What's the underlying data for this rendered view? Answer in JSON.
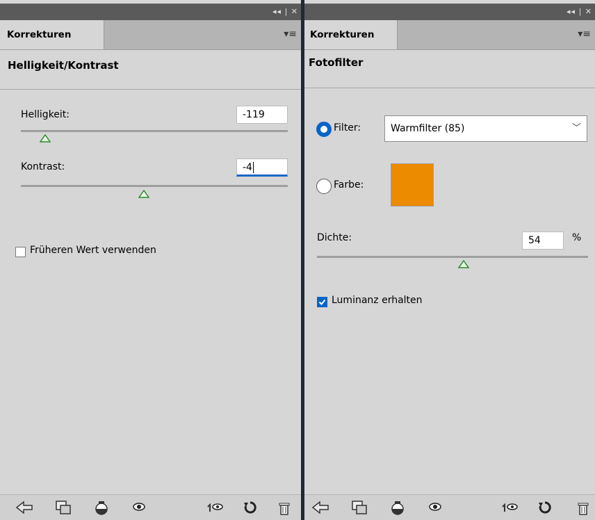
{
  "panels": [
    {
      "tab": "Korrekturen",
      "title": "Helligkeit/Kontrast",
      "controls": {
        "brightness": {
          "label": "Helligkeit:",
          "value": "-119",
          "slider_fraction": 0.09
        },
        "contrast": {
          "label": "Kontrast:",
          "value": "-4",
          "slider_fraction": 0.46
        },
        "legacy": {
          "label": "Früheren Wert verwenden",
          "checked": false
        }
      }
    },
    {
      "tab": "Korrekturen",
      "title": "Fotofilter",
      "controls": {
        "filter": {
          "label": "Filter:",
          "selected": true,
          "option": "Warmfilter (85)"
        },
        "color": {
          "label": "Farbe:",
          "selected": false,
          "swatch": "#ec8a00"
        },
        "density": {
          "label": "Dichte:",
          "value": "54",
          "unit": "%",
          "slider_fraction": 0.54
        },
        "preserve": {
          "label": "Luminanz erhalten",
          "checked": true
        }
      }
    }
  ],
  "colors": {
    "panel_bg": "#d6d6d6",
    "accent_blue": "#0a64c8",
    "slider_thumb": "#3c9a3c"
  },
  "icons": [
    "back-arrow-icon",
    "clip-layer-icon",
    "visibility-mask-icon",
    "eye-icon",
    "previous-state-icon",
    "reset-icon",
    "trash-icon"
  ]
}
